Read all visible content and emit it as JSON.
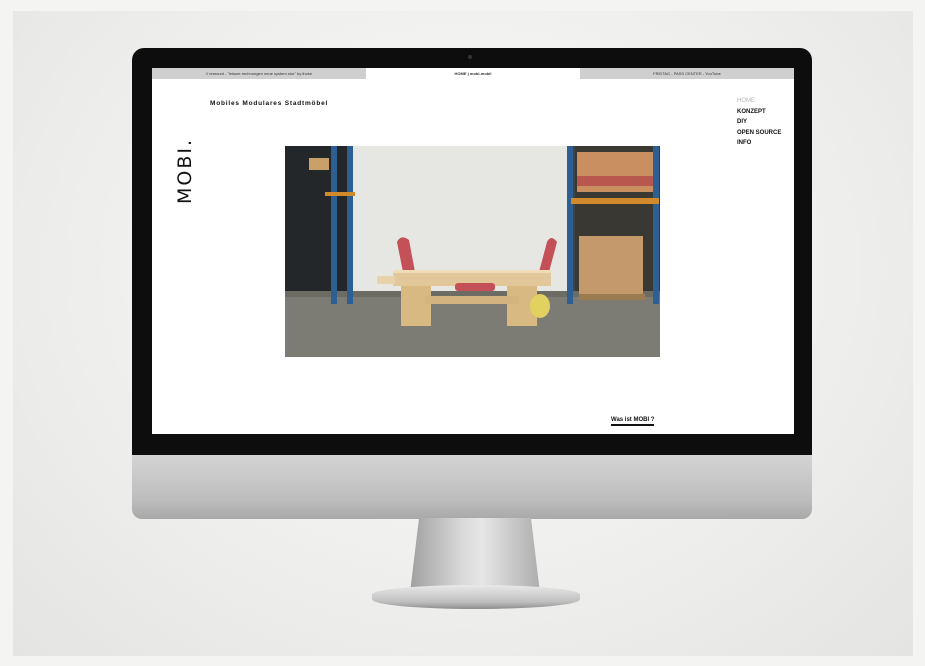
{
  "topbar": {
    "left": "// remount - \"leisure rechnungen neue system stor\" by thoke",
    "center": "HOME | mobi-mobil",
    "right": "FREITAG - PASS CENTER - YouTube"
  },
  "site": {
    "subtitle": "Mobiles Modulares Stadtmöbel",
    "logo": "MOBI."
  },
  "nav": {
    "items": [
      {
        "label": "HOME",
        "active": false
      },
      {
        "label": "KONZEPT",
        "active": true
      },
      {
        "label": "DIY",
        "active": true
      },
      {
        "label": "OPEN SOURCE",
        "active": true
      },
      {
        "label": "INFO",
        "active": true
      }
    ]
  },
  "cta": {
    "label": "Was ist MOBI ?"
  },
  "colors": {
    "background": "#f4f4f3",
    "bezel": "#0d0d0d",
    "screen": "#ffffff",
    "topbar": "#cfcfcf",
    "shelf_blue": "#2e5f93",
    "shelf_orange": "#d08a2c",
    "bench_wood": "#e2c79b",
    "bench_accent": "#c45058"
  }
}
